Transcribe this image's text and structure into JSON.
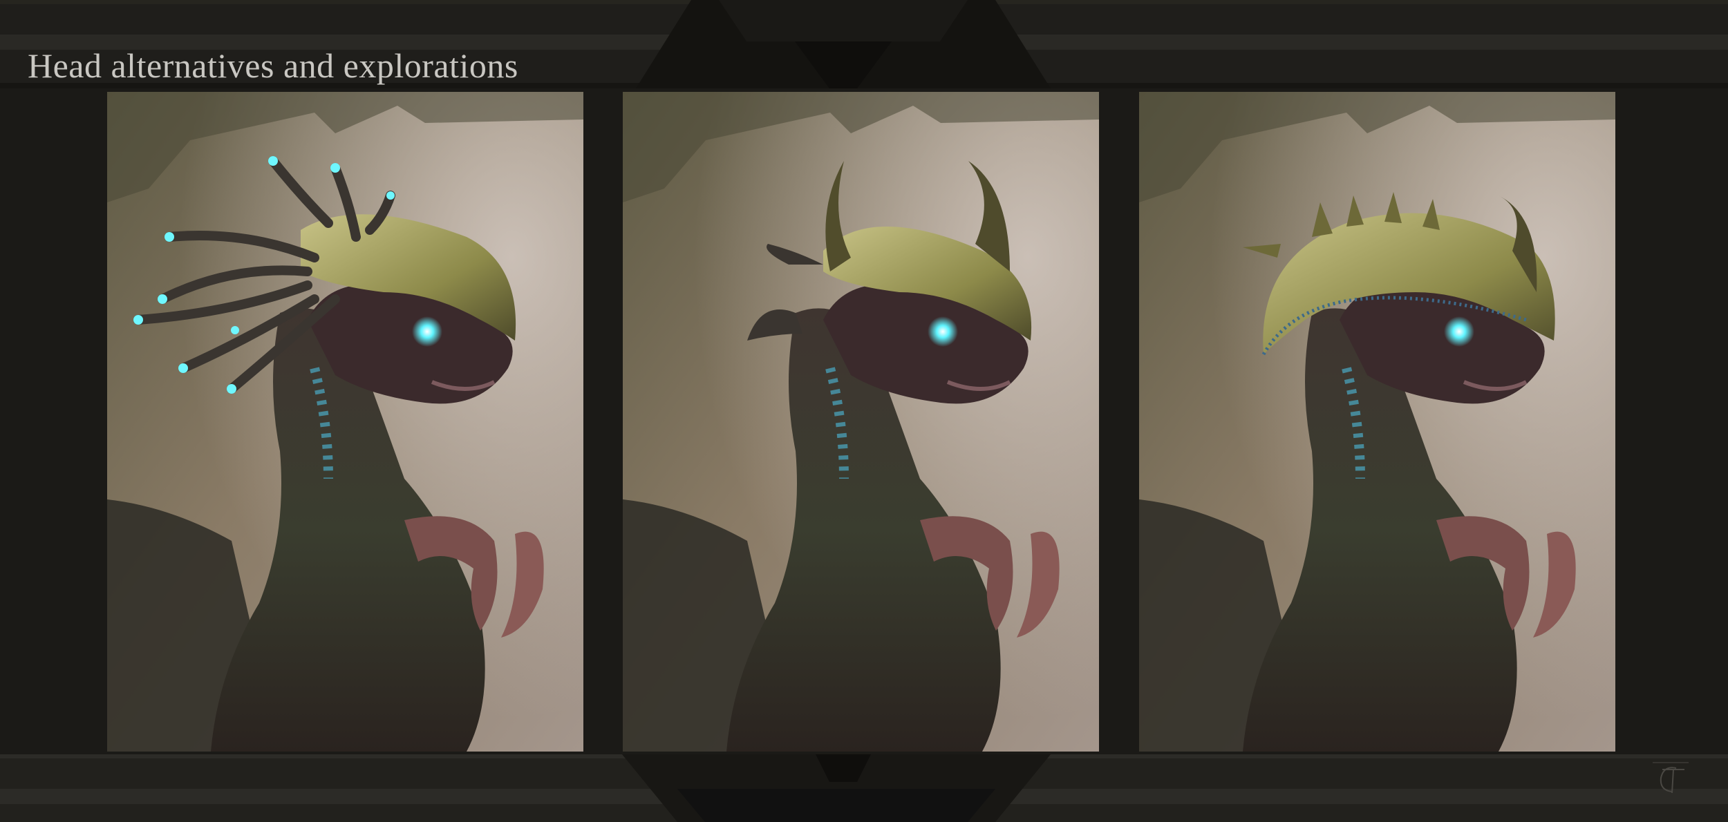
{
  "header": {
    "title": "Head alternatives and explorations"
  },
  "panels": [
    {
      "label": "",
      "variant": "tentacle-crest",
      "alt": "creature head with glowing tentacle crest"
    },
    {
      "label": "",
      "variant": "horned-crest",
      "alt": "creature head with curled horns"
    },
    {
      "label": "",
      "variant": "helmet-crest",
      "alt": "creature head with armored helmet"
    }
  ],
  "signature": {
    "icon": "artist-signature-icon"
  },
  "colors": {
    "background": "#1b1a17",
    "title": "#c9c7c2",
    "eye_glow": "#5ff4ff",
    "crest": "#a8a25c"
  }
}
